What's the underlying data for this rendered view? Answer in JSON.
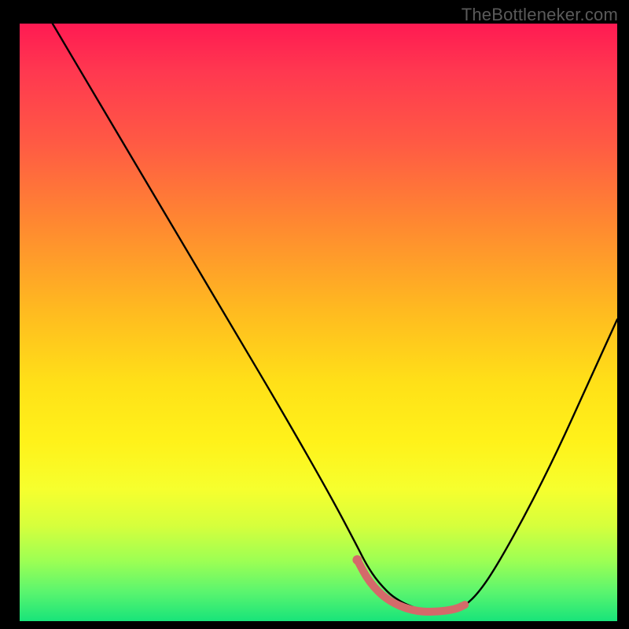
{
  "watermark": "TheBottleneker.com",
  "colors": {
    "curve": "#000000",
    "fit_stroke": "#d46a6a",
    "fit_dot": "#d46a6a",
    "bg_top": "#ff1a52",
    "bg_bottom": "#18e47a"
  },
  "chart_data": {
    "type": "line",
    "title": "",
    "xlabel": "",
    "ylabel": "",
    "xlim": [
      0,
      100
    ],
    "ylim": [
      0,
      100
    ],
    "series": [
      {
        "name": "bottleneck-curve",
        "x_frac": [
          0.055,
          0.12,
          0.2,
          0.28,
          0.36,
          0.44,
          0.52,
          0.565,
          0.58,
          0.6,
          0.63,
          0.68,
          0.72,
          0.745,
          0.77,
          0.8,
          0.85,
          0.9,
          0.95,
          1.0
        ],
        "y_frac_top": [
          0.0,
          0.11,
          0.245,
          0.38,
          0.515,
          0.65,
          0.79,
          0.875,
          0.905,
          0.935,
          0.965,
          0.985,
          0.985,
          0.975,
          0.95,
          0.905,
          0.815,
          0.715,
          0.605,
          0.495
        ]
      },
      {
        "name": "fit-highlight",
        "x_frac": [
          0.565,
          0.585,
          0.615,
          0.655,
          0.695,
          0.73,
          0.745
        ],
        "y_frac_top": [
          0.8975,
          0.935,
          0.965,
          0.9825,
          0.985,
          0.98,
          0.9725
        ]
      }
    ],
    "fit_dot": {
      "x_frac": 0.565,
      "y_frac_top": 0.8975
    }
  }
}
